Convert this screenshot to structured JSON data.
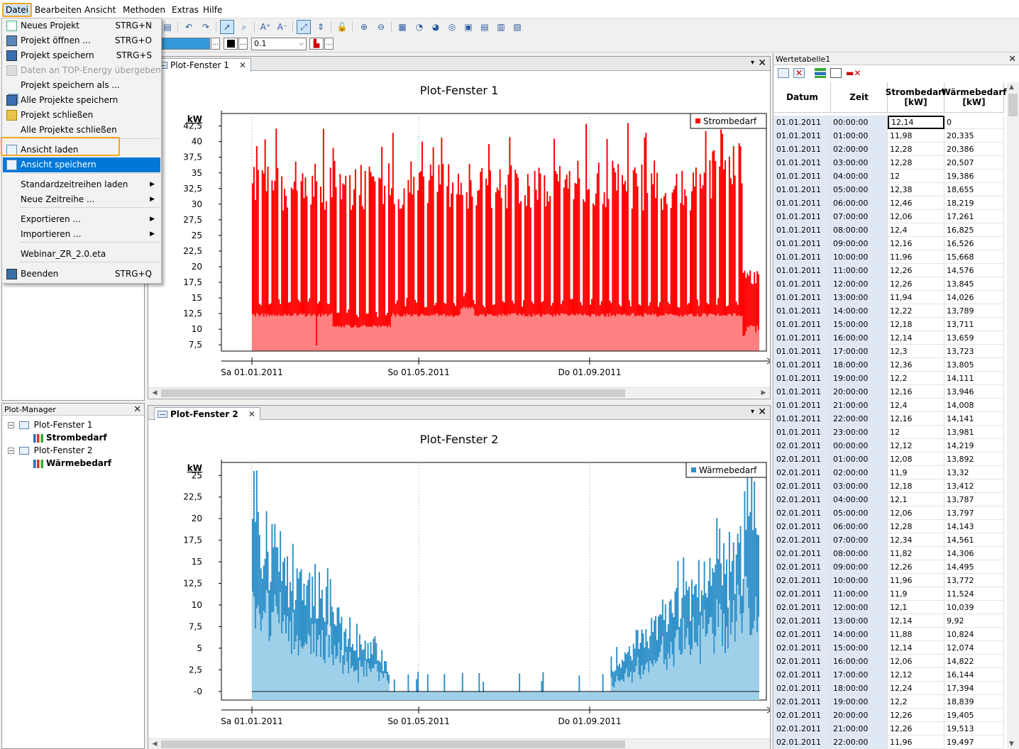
{
  "menubar": {
    "items": [
      "Datei",
      "Bearbeiten",
      "Ansicht",
      "Methoden",
      "Extras",
      "Hilfe"
    ]
  },
  "toolbar": {
    "line_width_value": "0.1"
  },
  "file_menu": {
    "items": [
      {
        "label": "Neues Projekt",
        "shortcut": "STRG+N",
        "icon": "new-project-icon"
      },
      {
        "label": "Projekt öffnen ...",
        "shortcut": "STRG+O",
        "icon": "open-project-icon"
      },
      {
        "label": "Projekt speichern",
        "shortcut": "STRG+S",
        "icon": "save-project-icon"
      },
      {
        "label": "Daten an TOP-Energy übergeben",
        "shortcut": "",
        "icon": "transfer-data-icon",
        "disabled": true
      },
      {
        "label": "Projekt speichern als ...",
        "shortcut": "",
        "icon": ""
      },
      {
        "label": "Alle Projekte speichern",
        "shortcut": "",
        "icon": "save-all-icon"
      },
      {
        "label": "Projekt schließen",
        "shortcut": "",
        "icon": "close-project-icon"
      },
      {
        "label": "Alle Projekte schließen",
        "shortcut": "",
        "icon": ""
      },
      {
        "label": "Ansicht laden",
        "shortcut": "",
        "icon": "load-view-icon"
      },
      {
        "label": "Ansicht speichern",
        "shortcut": "",
        "icon": "save-view-icon",
        "highlighted": true
      },
      {
        "label": "Standardzeitreihen laden",
        "shortcut": "",
        "icon": "",
        "submenu": true
      },
      {
        "label": "Neue Zeitreihe ...",
        "shortcut": "",
        "icon": "",
        "submenu": true
      },
      {
        "label": "Exportieren ...",
        "shortcut": "",
        "icon": "",
        "submenu": true
      },
      {
        "label": "Importieren ...",
        "shortcut": "",
        "icon": "",
        "submenu": true
      },
      {
        "label": "Webinar_ZR_2.0.eta",
        "shortcut": "",
        "icon": ""
      },
      {
        "label": "Beenden",
        "shortcut": "STRG+Q",
        "icon": "exit-icon"
      }
    ]
  },
  "plot_manager": {
    "title": "Plot-Manager",
    "windows": [
      {
        "name": "Plot-Fenster 1",
        "series": "Strombedarf"
      },
      {
        "name": "Plot-Fenster 2",
        "series": "Wärmebedarf"
      }
    ]
  },
  "plot1": {
    "tab": "Plot-Fenster 1",
    "title": "Plot-Fenster 1",
    "unit": "kW"
  },
  "plot2": {
    "tab": "Plot-Fenster 2",
    "title": "Plot-Fenster 2",
    "unit": "kW"
  },
  "chart_data": [
    {
      "type": "area",
      "title": "Plot-Fenster 1",
      "ylabel": "kW",
      "ylim": [
        6.5,
        44.5
      ],
      "yticks": [
        "42,5",
        "40",
        "37,5",
        "35",
        "32,5",
        "30",
        "27,5",
        "25",
        "22,5",
        "20",
        "17,5",
        "15",
        "12,5",
        "10",
        "7,5"
      ],
      "xticks": [
        "Sa 01.01.2011",
        "So 01.05.2011",
        "Do 01.09.2011"
      ],
      "x_range": [
        "01.01.2011",
        "31.12.2011"
      ],
      "grid": true,
      "legend": "top-right",
      "series": [
        {
          "name": "Strombedarf",
          "color": "#ff0000",
          "base_fill": "#ff8080",
          "typical_base_kW": 12.4,
          "typical_peak_kW": 36
        }
      ]
    },
    {
      "type": "area",
      "title": "Plot-Fenster 2",
      "ylabel": "kW",
      "ylim": [
        -1,
        26.5
      ],
      "yticks": [
        "25",
        "22,5",
        "20",
        "17,5",
        "15",
        "12,5",
        "10",
        "7,5",
        "5",
        "2,5",
        "-0"
      ],
      "xticks": [
        "Sa 01.01.2011",
        "So 01.05.2011",
        "Do 01.09.2011"
      ],
      "x_range": [
        "01.01.2011",
        "31.12.2011"
      ],
      "grid": true,
      "legend": "top-right",
      "series": [
        {
          "name": "Wärmebedarf",
          "color": "#2f90c8",
          "base_fill": "#9fd0ea",
          "winter_peak_kW": 26.5,
          "summer_kW": 0
        }
      ]
    }
  ],
  "value_table": {
    "title": "Wertetabelle1",
    "columns": [
      "Datum",
      "Zeit",
      "Strombedarf\n[kW]",
      "Wärmebedarf\n[kW]"
    ],
    "rows": [
      [
        "01.01.2011",
        "00:00:00",
        "12,14",
        "0"
      ],
      [
        "01.01.2011",
        "01:00:00",
        "11,98",
        "20,335"
      ],
      [
        "01.01.2011",
        "02:00:00",
        "12,28",
        "20,386"
      ],
      [
        "01.01.2011",
        "03:00:00",
        "12,28",
        "20,507"
      ],
      [
        "01.01.2011",
        "04:00:00",
        "12",
        "19,386"
      ],
      [
        "01.01.2011",
        "05:00:00",
        "12,38",
        "18,655"
      ],
      [
        "01.01.2011",
        "06:00:00",
        "12,46",
        "18,219"
      ],
      [
        "01.01.2011",
        "07:00:00",
        "12,06",
        "17,261"
      ],
      [
        "01.01.2011",
        "08:00:00",
        "12,4",
        "16,825"
      ],
      [
        "01.01.2011",
        "09:00:00",
        "12,16",
        "16,526"
      ],
      [
        "01.01.2011",
        "10:00:00",
        "11,96",
        "15,668"
      ],
      [
        "01.01.2011",
        "11:00:00",
        "12,26",
        "14,576"
      ],
      [
        "01.01.2011",
        "12:00:00",
        "12,26",
        "13,845"
      ],
      [
        "01.01.2011",
        "13:00:00",
        "11,94",
        "14,026"
      ],
      [
        "01.01.2011",
        "14:00:00",
        "12,22",
        "13,789"
      ],
      [
        "01.01.2011",
        "15:00:00",
        "12,18",
        "13,711"
      ],
      [
        "01.01.2011",
        "16:00:00",
        "12,14",
        "13,659"
      ],
      [
        "01.01.2011",
        "17:00:00",
        "12,3",
        "13,723"
      ],
      [
        "01.01.2011",
        "18:00:00",
        "12,36",
        "13,805"
      ],
      [
        "01.01.2011",
        "19:00:00",
        "12,2",
        "14,111"
      ],
      [
        "01.01.2011",
        "20:00:00",
        "12,16",
        "13,946"
      ],
      [
        "01.01.2011",
        "21:00:00",
        "12,4",
        "14,008"
      ],
      [
        "01.01.2011",
        "22:00:00",
        "12,16",
        "14,141"
      ],
      [
        "01.01.2011",
        "23:00:00",
        "12",
        "13,981"
      ],
      [
        "02.01.2011",
        "00:00:00",
        "12,12",
        "14,219"
      ],
      [
        "02.01.2011",
        "01:00:00",
        "12,08",
        "13,892"
      ],
      [
        "02.01.2011",
        "02:00:00",
        "11,9",
        "13,32"
      ],
      [
        "02.01.2011",
        "03:00:00",
        "12,18",
        "13,412"
      ],
      [
        "02.01.2011",
        "04:00:00",
        "12,1",
        "13,787"
      ],
      [
        "02.01.2011",
        "05:00:00",
        "12,06",
        "13,797"
      ],
      [
        "02.01.2011",
        "06:00:00",
        "12,28",
        "14,143"
      ],
      [
        "02.01.2011",
        "07:00:00",
        "12,34",
        "14,561"
      ],
      [
        "02.01.2011",
        "08:00:00",
        "11,82",
        "14,306"
      ],
      [
        "02.01.2011",
        "09:00:00",
        "12,26",
        "14,495"
      ],
      [
        "02.01.2011",
        "10:00:00",
        "11,96",
        "13,772"
      ],
      [
        "02.01.2011",
        "11:00:00",
        "11,9",
        "11,524"
      ],
      [
        "02.01.2011",
        "12:00:00",
        "12,1",
        "10,039"
      ],
      [
        "02.01.2011",
        "13:00:00",
        "12,14",
        "9,92"
      ],
      [
        "02.01.2011",
        "14:00:00",
        "11,88",
        "10,824"
      ],
      [
        "02.01.2011",
        "15:00:00",
        "12,14",
        "12,074"
      ],
      [
        "02.01.2011",
        "16:00:00",
        "12,06",
        "14,822"
      ],
      [
        "02.01.2011",
        "17:00:00",
        "12,12",
        "16,144"
      ],
      [
        "02.01.2011",
        "18:00:00",
        "12,24",
        "17,394"
      ],
      [
        "02.01.2011",
        "19:00:00",
        "12,2",
        "18,839"
      ],
      [
        "02.01.2011",
        "20:00:00",
        "12,26",
        "19,405"
      ],
      [
        "02.01.2011",
        "21:00:00",
        "12,26",
        "19,513"
      ],
      [
        "02.01.2011",
        "22:00:00",
        "11,96",
        "19,497"
      ]
    ]
  },
  "colors": {
    "accent": "#0078d7",
    "highlight_border": "#f5a623",
    "strom": "#ff0000",
    "strom_base": "#ff8080",
    "waerme": "#2f90c8",
    "waerme_base": "#9fd0ea"
  }
}
